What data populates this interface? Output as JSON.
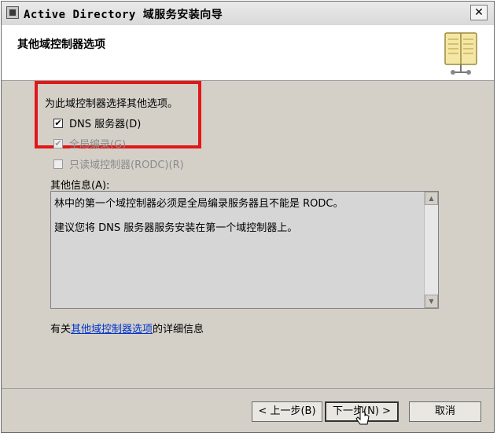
{
  "window": {
    "title": "Active Directory 域服务安装向导",
    "close_label": "✕"
  },
  "header": {
    "title": "其他域控制器选项"
  },
  "options": {
    "prompt": "为此域控制器选择其他选项。",
    "dns": {
      "label": "DNS 服务器(D)",
      "checked": true,
      "enabled": true
    },
    "gc": {
      "label": "全局编录(G)",
      "checked": true,
      "enabled": false
    },
    "rodc": {
      "label": "只读域控制器(RODC)(R)",
      "checked": false,
      "enabled": false
    }
  },
  "info": {
    "label": "其他信息(A):",
    "lines": [
      "林中的第一个域控制器必须是全局编录服务器且不能是 RODC。",
      "建议您将 DNS 服务器服务安装在第一个域控制器上。"
    ]
  },
  "more_info": {
    "prefix": "有关",
    "link": "其他域控制器选项",
    "suffix": "的详细信息"
  },
  "buttons": {
    "back": "< 上一步(B)",
    "next": "下一步(N) >",
    "cancel": "取消"
  },
  "checkmark": "✔",
  "icons": [
    "book-icon",
    "close-icon",
    "scroll-up-icon",
    "scroll-down-icon",
    "mouse-cursor-icon"
  ]
}
